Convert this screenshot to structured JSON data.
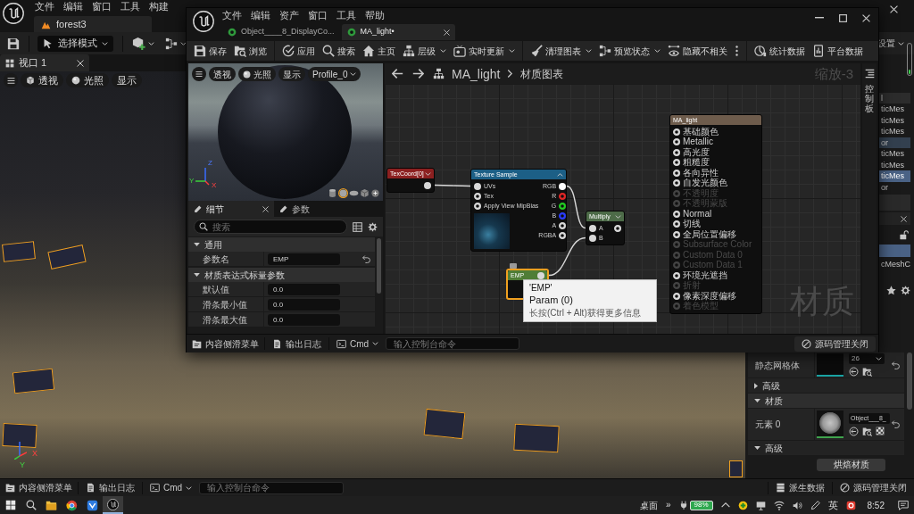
{
  "editor": {
    "menu": [
      "文件",
      "编辑",
      "窗口",
      "工具",
      "构建"
    ],
    "level_tab": "forest3",
    "toolbar": {
      "mode": "选择模式",
      "settings": "设置"
    },
    "viewport": {
      "tab": "视口 1",
      "buttons": [
        "透视",
        "光照",
        "显示"
      ],
      "gizmo_axes": [
        "X",
        "Y"
      ]
    },
    "outliner": {
      "header": "l",
      "rows": [
        {
          "label": "ticMes",
          "selected": false,
          "highlighted": false
        },
        {
          "label": "ticMes",
          "selected": false,
          "highlighted": false
        },
        {
          "label": "ticMes",
          "selected": false,
          "highlighted": false
        },
        {
          "label": "or",
          "selected": false,
          "highlighted": true
        },
        {
          "label": "ticMes",
          "selected": false,
          "highlighted": false
        },
        {
          "label": "ticMes",
          "selected": false,
          "highlighted": false
        },
        {
          "label": "ticMes",
          "selected": true,
          "highlighted": false
        },
        {
          "label": "or",
          "selected": false,
          "highlighted": false
        }
      ]
    },
    "details": {
      "components": [
        {
          "selected": true
        },
        {
          "label": "cMeshC",
          "selected": false
        }
      ],
      "rows": [
        {
          "kind": "mesh",
          "label": "静态网格体",
          "value": "26"
        },
        {
          "kind": "group",
          "label": "高级",
          "expanded": false
        },
        {
          "kind": "category",
          "label": "材质",
          "expanded": true
        },
        {
          "kind": "material",
          "label": "元素 0",
          "value": "Object___8_"
        },
        {
          "kind": "group",
          "label": "高级",
          "expanded": true
        },
        {
          "kind": "action",
          "label": "烘焙材质"
        }
      ]
    },
    "status_bar": {
      "drawer": "内容侧滑菜单",
      "log": "输出日志",
      "cmd": "Cmd",
      "console_placeholder": "输入控制台命令",
      "derived_data": "派生数据",
      "source_control": "源码管理关闭"
    }
  },
  "material_editor": {
    "menu": [
      "文件",
      "编辑",
      "资产",
      "窗口",
      "工具",
      "帮助"
    ],
    "tabs": [
      {
        "label": "Object____8_DisplayCo...",
        "selected": false,
        "closable": false
      },
      {
        "label": "MA_light•",
        "selected": true,
        "closable": true
      }
    ],
    "toolbar": [
      {
        "items": [
          {
            "label": "保存",
            "dropdown": false
          },
          {
            "label": "浏览",
            "dropdown": false
          }
        ]
      },
      {
        "items": [
          {
            "label": "应用",
            "dropdown": false
          },
          {
            "label": "搜索",
            "dropdown": false
          },
          {
            "label": "主页",
            "dropdown": false
          },
          {
            "label": "层级",
            "dropdown": true
          },
          {
            "label": "实时更新",
            "dropdown": true
          }
        ]
      },
      {
        "items": [
          {
            "label": "清理图表",
            "dropdown": true
          },
          {
            "label": "预览状态",
            "dropdown": true
          },
          {
            "label": "隐藏不相关",
            "dropdown": false
          }
        ],
        "overflow": true
      },
      {
        "items": [
          {
            "label": "统计数据",
            "dropdown": false
          },
          {
            "label": "平台数据",
            "dropdown": false
          }
        ]
      }
    ],
    "preview": {
      "buttons": [
        "透视",
        "光照",
        "显示"
      ],
      "profile": "Profile_0",
      "gizmo_axes": [
        "Z",
        "Y",
        "X"
      ],
      "meshes": [
        {
          "selected": false
        },
        {
          "selected": true
        },
        {
          "selected": false
        },
        {
          "selected": false
        },
        {
          "selected": false
        }
      ]
    },
    "details": {
      "tabs": [
        {
          "label": "细节",
          "selected": true,
          "closable": true
        },
        {
          "label": "参数",
          "selected": false,
          "closable": false
        }
      ],
      "search_placeholder": "搜索",
      "sections": [
        {
          "label": "通用",
          "expanded": true,
          "rows": [
            {
              "label": "参数名",
              "value": "EMP",
              "resettable": true
            }
          ]
        },
        {
          "label": "材质表达式标量参数",
          "expanded": true,
          "rows": [
            {
              "label": "默认值",
              "value": "0.0",
              "resettable": false
            },
            {
              "label": "滑条最小值",
              "value": "0.0",
              "resettable": false
            },
            {
              "label": "滑条最大值",
              "value": "0.0",
              "resettable": false
            }
          ]
        }
      ]
    },
    "graph": {
      "breadcrumb": {
        "asset": "MA_light",
        "graph": "材质图表"
      },
      "zoom": "缩放-3",
      "watermark": "材质",
      "nodes": [
        {
          "kind": "coordinate",
          "title": "TexCoord[0]",
          "color": "#8c2020",
          "selected": false,
          "expanded": false,
          "outputs": [
            {
              "connected": true
            }
          ]
        },
        {
          "kind": "sampler",
          "title": "Texture Sample",
          "color": "#1c5f86",
          "selected": false,
          "expanded": true,
          "inputs": [
            {
              "label": "UVs",
              "connected": true
            },
            {
              "label": "Tex",
              "connected": false
            },
            {
              "label": "Apply View MipBias",
              "connected": false
            }
          ],
          "outputs": [
            {
              "label": "RGB",
              "connected": true,
              "color": "#ffffff"
            },
            {
              "label": "R",
              "connected": false,
              "color": "#e02626"
            },
            {
              "label": "G",
              "connected": false,
              "color": "#22cc22"
            },
            {
              "label": "B",
              "connected": false,
              "color": "#2a3cff"
            },
            {
              "label": "A",
              "connected": false,
              "color": "#d8d8d8"
            },
            {
              "label": "RGBA",
              "connected": false,
              "color": "#d8d8d8"
            }
          ]
        },
        {
          "kind": "operator",
          "title": "Multiply",
          "color": "#4d6b48",
          "selected": false,
          "expanded": false,
          "inputs": [
            {
              "label": "A",
              "connected": true
            },
            {
              "label": "B",
              "connected": true
            }
          ],
          "outputs": [
            {
              "connected": false
            }
          ]
        },
        {
          "kind": "parameter",
          "title": "EMP",
          "color": "#4f7d36",
          "selected": true,
          "outputs": [
            {
              "connected": true
            }
          ]
        },
        {
          "kind": "result",
          "title": "MA_light",
          "color": "#6e5c4c",
          "selected": false,
          "inputs": [
            {
              "label": "基础颜色",
              "connected": false,
              "enabled": true
            },
            {
              "label": "Metallic",
              "connected": false,
              "enabled": true
            },
            {
              "label": "高光度",
              "connected": false,
              "enabled": true
            },
            {
              "label": "粗糙度",
              "connected": false,
              "enabled": true
            },
            {
              "label": "各向异性",
              "connected": false,
              "enabled": true
            },
            {
              "label": "自发光颜色",
              "connected": false,
              "enabled": true
            },
            {
              "label": "不透明度",
              "connected": false,
              "enabled": false
            },
            {
              "label": "不透明蒙版",
              "connected": false,
              "enabled": false
            },
            {
              "label": "Normal",
              "connected": false,
              "enabled": true
            },
            {
              "label": "切线",
              "connected": false,
              "enabled": true
            },
            {
              "label": "全局位置偏移",
              "connected": false,
              "enabled": true
            },
            {
              "label": "Subsurface Color",
              "connected": false,
              "enabled": false
            },
            {
              "label": "Custom Data 0",
              "connected": false,
              "enabled": false
            },
            {
              "label": "Custom Data 1",
              "connected": false,
              "enabled": false
            },
            {
              "label": "环境光遮挡",
              "connected": false,
              "enabled": true
            },
            {
              "label": "折射",
              "connected": false,
              "enabled": false
            },
            {
              "label": "像素深度偏移",
              "connected": false,
              "enabled": true
            },
            {
              "label": "着色模型",
              "connected": false,
              "enabled": false
            }
          ]
        }
      ],
      "tooltip": {
        "title": "'EMP'",
        "subtitle": "Param (0)",
        "hint": "长按(Ctrl + Alt)获得更多信息"
      }
    },
    "palette_tab": "控制板",
    "status_bar": {
      "drawer": "内容侧滑菜单",
      "log": "输出日志",
      "cmd": "Cmd",
      "console_placeholder": "输入控制台命令",
      "source_control": "源码管理关闭"
    }
  },
  "taskbar": {
    "apps": [
      {
        "active": false
      },
      {
        "active": false
      },
      {
        "active": false
      },
      {
        "active": true
      }
    ],
    "desktop": "桌面",
    "overflow": "»",
    "battery": "98%",
    "ime": "英",
    "time": "8:52"
  }
}
